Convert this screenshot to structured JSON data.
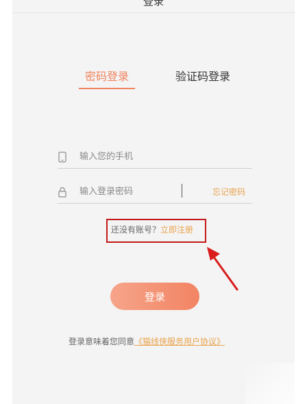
{
  "header": {
    "title": "登录"
  },
  "tabs": [
    {
      "label": "密码登录",
      "active": true
    },
    {
      "label": "验证码登录",
      "active": false
    }
  ],
  "form": {
    "phone": {
      "placeholder": "输入您的手机",
      "icon": "phone-icon"
    },
    "password": {
      "placeholder": "输入登录密码",
      "icon": "lock-icon"
    },
    "forgot_label": "忘记密码"
  },
  "register": {
    "prompt": "还没有账号？",
    "link_label": "立即注册"
  },
  "login_button": {
    "label": "登录"
  },
  "agreement": {
    "prefix": "登录意味着您同意",
    "link_label": "《猫线侠服务用户协议》"
  },
  "colors": {
    "accent": "#f0845e",
    "link": "#e9a34d",
    "highlight_box": "#c41919",
    "button_gradient_start": "#f6a48a",
    "button_gradient_end": "#f28463"
  }
}
